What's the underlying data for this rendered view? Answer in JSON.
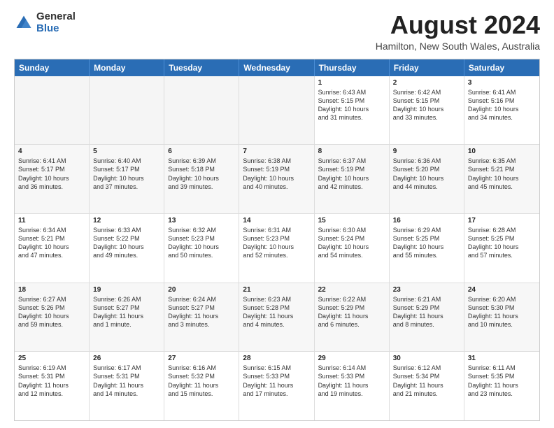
{
  "logo": {
    "general": "General",
    "blue": "Blue"
  },
  "title": {
    "month_year": "August 2024",
    "location": "Hamilton, New South Wales, Australia"
  },
  "header_days": [
    "Sunday",
    "Monday",
    "Tuesday",
    "Wednesday",
    "Thursday",
    "Friday",
    "Saturday"
  ],
  "weeks": [
    [
      {
        "day": "",
        "details": "",
        "empty": true
      },
      {
        "day": "",
        "details": "",
        "empty": true
      },
      {
        "day": "",
        "details": "",
        "empty": true
      },
      {
        "day": "",
        "details": "",
        "empty": true
      },
      {
        "day": "1",
        "details": "Sunrise: 6:43 AM\nSunset: 5:15 PM\nDaylight: 10 hours\nand 31 minutes."
      },
      {
        "day": "2",
        "details": "Sunrise: 6:42 AM\nSunset: 5:15 PM\nDaylight: 10 hours\nand 33 minutes."
      },
      {
        "day": "3",
        "details": "Sunrise: 6:41 AM\nSunset: 5:16 PM\nDaylight: 10 hours\nand 34 minutes."
      }
    ],
    [
      {
        "day": "4",
        "details": "Sunrise: 6:41 AM\nSunset: 5:17 PM\nDaylight: 10 hours\nand 36 minutes."
      },
      {
        "day": "5",
        "details": "Sunrise: 6:40 AM\nSunset: 5:17 PM\nDaylight: 10 hours\nand 37 minutes."
      },
      {
        "day": "6",
        "details": "Sunrise: 6:39 AM\nSunset: 5:18 PM\nDaylight: 10 hours\nand 39 minutes."
      },
      {
        "day": "7",
        "details": "Sunrise: 6:38 AM\nSunset: 5:19 PM\nDaylight: 10 hours\nand 40 minutes."
      },
      {
        "day": "8",
        "details": "Sunrise: 6:37 AM\nSunset: 5:19 PM\nDaylight: 10 hours\nand 42 minutes."
      },
      {
        "day": "9",
        "details": "Sunrise: 6:36 AM\nSunset: 5:20 PM\nDaylight: 10 hours\nand 44 minutes."
      },
      {
        "day": "10",
        "details": "Sunrise: 6:35 AM\nSunset: 5:21 PM\nDaylight: 10 hours\nand 45 minutes."
      }
    ],
    [
      {
        "day": "11",
        "details": "Sunrise: 6:34 AM\nSunset: 5:21 PM\nDaylight: 10 hours\nand 47 minutes."
      },
      {
        "day": "12",
        "details": "Sunrise: 6:33 AM\nSunset: 5:22 PM\nDaylight: 10 hours\nand 49 minutes."
      },
      {
        "day": "13",
        "details": "Sunrise: 6:32 AM\nSunset: 5:23 PM\nDaylight: 10 hours\nand 50 minutes."
      },
      {
        "day": "14",
        "details": "Sunrise: 6:31 AM\nSunset: 5:23 PM\nDaylight: 10 hours\nand 52 minutes."
      },
      {
        "day": "15",
        "details": "Sunrise: 6:30 AM\nSunset: 5:24 PM\nDaylight: 10 hours\nand 54 minutes."
      },
      {
        "day": "16",
        "details": "Sunrise: 6:29 AM\nSunset: 5:25 PM\nDaylight: 10 hours\nand 55 minutes."
      },
      {
        "day": "17",
        "details": "Sunrise: 6:28 AM\nSunset: 5:25 PM\nDaylight: 10 hours\nand 57 minutes."
      }
    ],
    [
      {
        "day": "18",
        "details": "Sunrise: 6:27 AM\nSunset: 5:26 PM\nDaylight: 10 hours\nand 59 minutes."
      },
      {
        "day": "19",
        "details": "Sunrise: 6:26 AM\nSunset: 5:27 PM\nDaylight: 11 hours\nand 1 minute."
      },
      {
        "day": "20",
        "details": "Sunrise: 6:24 AM\nSunset: 5:27 PM\nDaylight: 11 hours\nand 3 minutes."
      },
      {
        "day": "21",
        "details": "Sunrise: 6:23 AM\nSunset: 5:28 PM\nDaylight: 11 hours\nand 4 minutes."
      },
      {
        "day": "22",
        "details": "Sunrise: 6:22 AM\nSunset: 5:29 PM\nDaylight: 11 hours\nand 6 minutes."
      },
      {
        "day": "23",
        "details": "Sunrise: 6:21 AM\nSunset: 5:29 PM\nDaylight: 11 hours\nand 8 minutes."
      },
      {
        "day": "24",
        "details": "Sunrise: 6:20 AM\nSunset: 5:30 PM\nDaylight: 11 hours\nand 10 minutes."
      }
    ],
    [
      {
        "day": "25",
        "details": "Sunrise: 6:19 AM\nSunset: 5:31 PM\nDaylight: 11 hours\nand 12 minutes."
      },
      {
        "day": "26",
        "details": "Sunrise: 6:17 AM\nSunset: 5:31 PM\nDaylight: 11 hours\nand 14 minutes."
      },
      {
        "day": "27",
        "details": "Sunrise: 6:16 AM\nSunset: 5:32 PM\nDaylight: 11 hours\nand 15 minutes."
      },
      {
        "day": "28",
        "details": "Sunrise: 6:15 AM\nSunset: 5:33 PM\nDaylight: 11 hours\nand 17 minutes."
      },
      {
        "day": "29",
        "details": "Sunrise: 6:14 AM\nSunset: 5:33 PM\nDaylight: 11 hours\nand 19 minutes."
      },
      {
        "day": "30",
        "details": "Sunrise: 6:12 AM\nSunset: 5:34 PM\nDaylight: 11 hours\nand 21 minutes."
      },
      {
        "day": "31",
        "details": "Sunrise: 6:11 AM\nSunset: 5:35 PM\nDaylight: 11 hours\nand 23 minutes."
      }
    ]
  ]
}
